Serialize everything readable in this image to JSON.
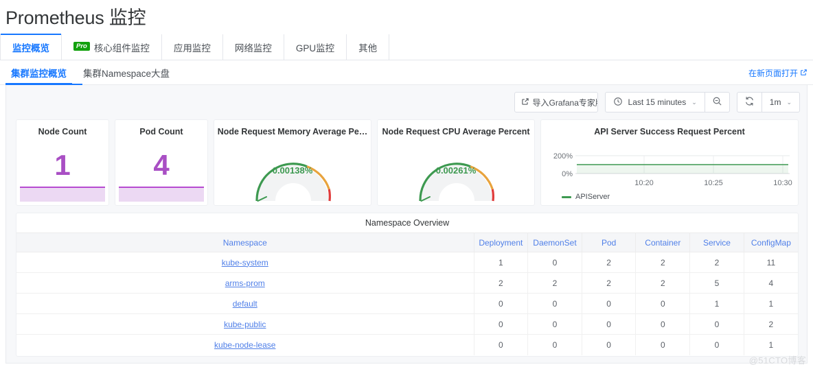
{
  "header": {
    "title": "Prometheus 监控"
  },
  "tabs": [
    {
      "label": "监控概览",
      "badge": null,
      "active": true
    },
    {
      "label": "核心组件监控",
      "badge": "Pro",
      "active": false
    },
    {
      "label": "应用监控",
      "badge": null,
      "active": false
    },
    {
      "label": "网络监控",
      "badge": null,
      "active": false
    },
    {
      "label": "GPU监控",
      "badge": null,
      "active": false
    },
    {
      "label": "其他",
      "badge": null,
      "active": false
    }
  ],
  "subtabs": [
    {
      "label": "集群监控概览",
      "active": true
    },
    {
      "label": "集群Namespace大盘",
      "active": false
    }
  ],
  "open_in_new_page": {
    "label": "在新页面打开",
    "icon": "external-link-icon"
  },
  "toolbar": {
    "grafana_import": {
      "label": "导入Grafana专家版",
      "icon": "external-link-icon"
    },
    "time_range": {
      "label": "Last 15 minutes",
      "icon": "clock-icon",
      "caret": "⌄"
    },
    "zoom_out": {
      "icon": "zoom-out-icon"
    },
    "refresh": {
      "icon": "refresh-icon"
    },
    "refresh_interval": {
      "label": "1m",
      "caret": "⌄"
    }
  },
  "panels": {
    "node_count": {
      "title": "Node Count",
      "value": "1",
      "color": "#a94fc4"
    },
    "pod_count": {
      "title": "Pod Count",
      "value": "4",
      "color": "#a94fc4"
    },
    "node_request_memory": {
      "title": "Node Request Memory Average Pe…",
      "value": "0.00138%"
    },
    "node_request_cpu": {
      "title": "Node Request CPU Average Percent",
      "value": "0.00261%"
    },
    "api_server": {
      "title": "API Server Success Request Percent",
      "legend": "APIServer"
    }
  },
  "chart_data": [
    {
      "type": "gauge",
      "title": "Node Request Memory Average Pe…",
      "value": 0.00138,
      "value_label": "0.00138%",
      "min": 0,
      "max": 100,
      "bands": [
        {
          "from": 0,
          "to": 60,
          "color": "#3d9950"
        },
        {
          "from": 60,
          "to": 90,
          "color": "#e8a33d"
        },
        {
          "from": 90,
          "to": 100,
          "color": "#e03b3b"
        }
      ]
    },
    {
      "type": "gauge",
      "title": "Node Request CPU Average Percent",
      "value": 0.00261,
      "value_label": "0.00261%",
      "min": 0,
      "max": 100,
      "bands": [
        {
          "from": 0,
          "to": 60,
          "color": "#3d9950"
        },
        {
          "from": 60,
          "to": 90,
          "color": "#e8a33d"
        },
        {
          "from": 90,
          "to": 100,
          "color": "#e03b3b"
        }
      ]
    },
    {
      "type": "area",
      "title": "API Server Success Request Percent",
      "xlabel": "",
      "ylabel": "",
      "ylim": [
        0,
        200
      ],
      "ytick_labels": [
        "200%",
        "0%"
      ],
      "ytick_values": [
        200,
        0
      ],
      "xtick_labels": [
        "10:20",
        "10:25",
        "10:30"
      ],
      "grid": true,
      "legend_position": "bottom-left",
      "series": [
        {
          "name": "APIServer",
          "color": "#3d9950",
          "x": [
            "10:17",
            "10:19",
            "10:21",
            "10:23",
            "10:25",
            "10:27",
            "10:29",
            "10:31",
            "10:32"
          ],
          "values": [
            100,
            100,
            100,
            100,
            100,
            100,
            100,
            100,
            100
          ]
        }
      ]
    }
  ],
  "table": {
    "title": "Namespace Overview",
    "columns": [
      "Namespace",
      "Deployment",
      "DaemonSet",
      "Pod",
      "Container",
      "Service",
      "ConfigMap"
    ],
    "rows": [
      {
        "namespace": "kube-system",
        "deployment": "1",
        "daemonset": "0",
        "pod": "2",
        "container": "2",
        "service": "2",
        "configmap": "11"
      },
      {
        "namespace": "arms-prom",
        "deployment": "2",
        "daemonset": "2",
        "pod": "2",
        "container": "2",
        "service": "5",
        "configmap": "4"
      },
      {
        "namespace": "default",
        "deployment": "0",
        "daemonset": "0",
        "pod": "0",
        "container": "0",
        "service": "1",
        "configmap": "1"
      },
      {
        "namespace": "kube-public",
        "deployment": "0",
        "daemonset": "0",
        "pod": "0",
        "container": "0",
        "service": "0",
        "configmap": "2"
      },
      {
        "namespace": "kube-node-lease",
        "deployment": "0",
        "daemonset": "0",
        "pod": "0",
        "container": "0",
        "service": "0",
        "configmap": "1"
      }
    ]
  },
  "watermark": "@51CTO博客",
  "colors": {
    "accent": "#1677ff",
    "link": "#4f7fe8",
    "stat": "#a94fc4",
    "gauge_good": "#3d9950",
    "gauge_warn": "#e8a33d",
    "gauge_bad": "#e03b3b",
    "pro_badge": "#13a10e"
  }
}
